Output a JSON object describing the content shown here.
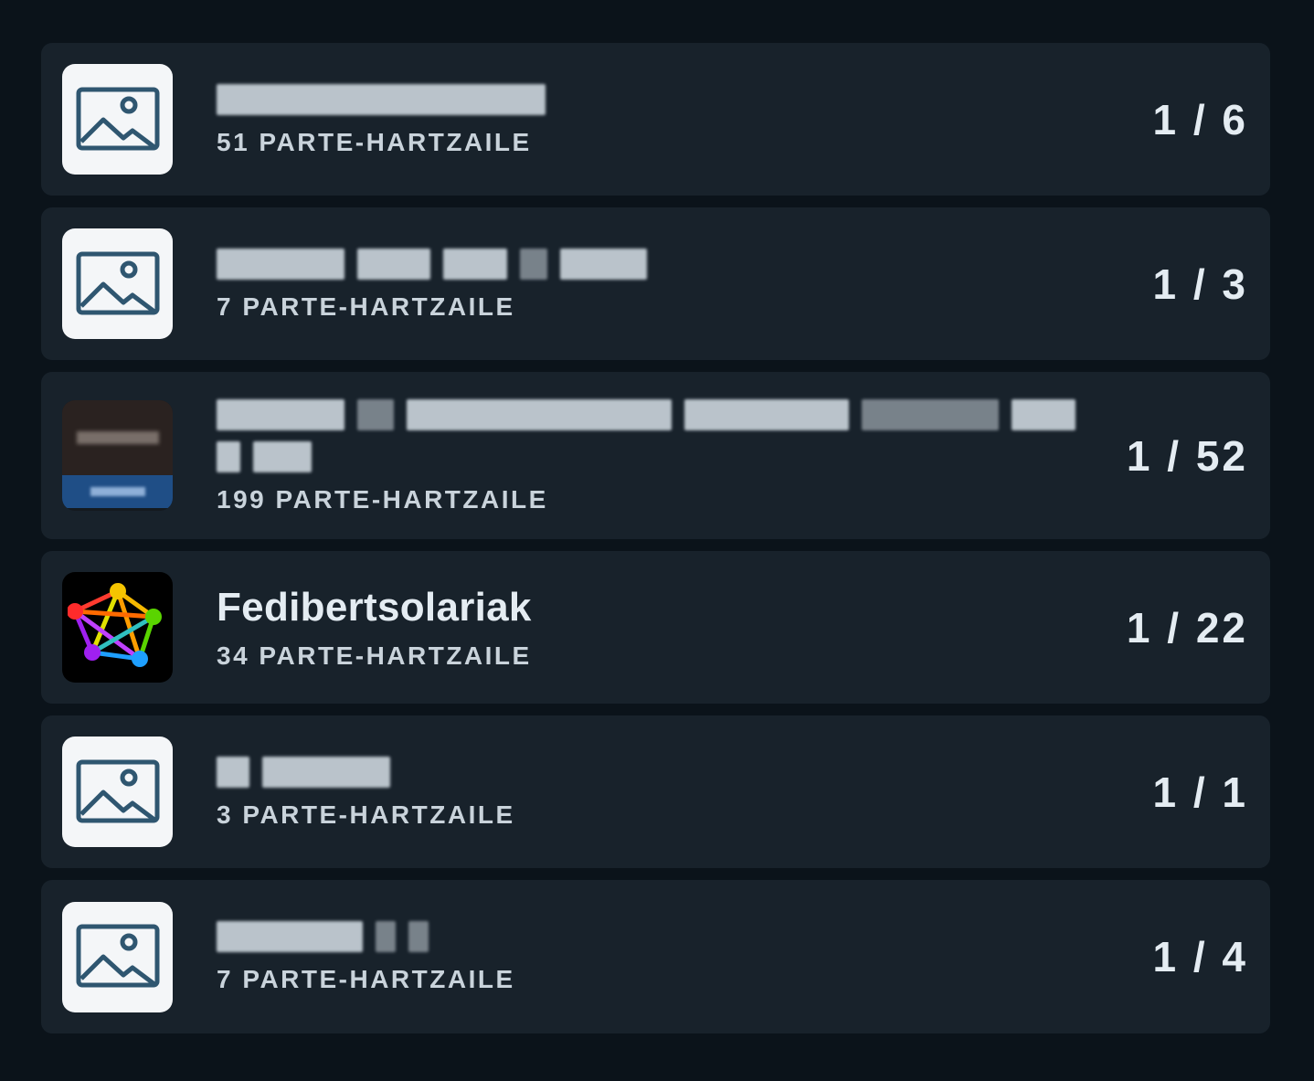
{
  "rooms": [
    {
      "avatar": "image-placeholder",
      "name_redacted": true,
      "participants": "51 PARTE-HARTZAILE",
      "count": "1 / 6"
    },
    {
      "avatar": "image-placeholder",
      "name_redacted": true,
      "participants": "7 PARTE-HARTZAILE",
      "count": "1 / 3"
    },
    {
      "avatar": "photo",
      "name_redacted": true,
      "participants": "199 PARTE-HARTZAILE",
      "count": "1 / 52"
    },
    {
      "avatar": "fediverse-pentagram",
      "name": "Fedibertsolariak",
      "participants": "34 PARTE-HARTZAILE",
      "count": "1 / 22"
    },
    {
      "avatar": "image-placeholder",
      "name_redacted": true,
      "participants": "3 PARTE-HARTZAILE",
      "count": "1 / 1"
    },
    {
      "avatar": "image-placeholder",
      "name_redacted": true,
      "participants": "7 PARTE-HARTZAILE",
      "count": "1 / 4"
    }
  ],
  "colors": {
    "background": "#0b131a",
    "card": "#18222b",
    "text": "#e4ecf2",
    "subtext": "#c9d3db",
    "placeholder_icon": "#2f5670"
  }
}
